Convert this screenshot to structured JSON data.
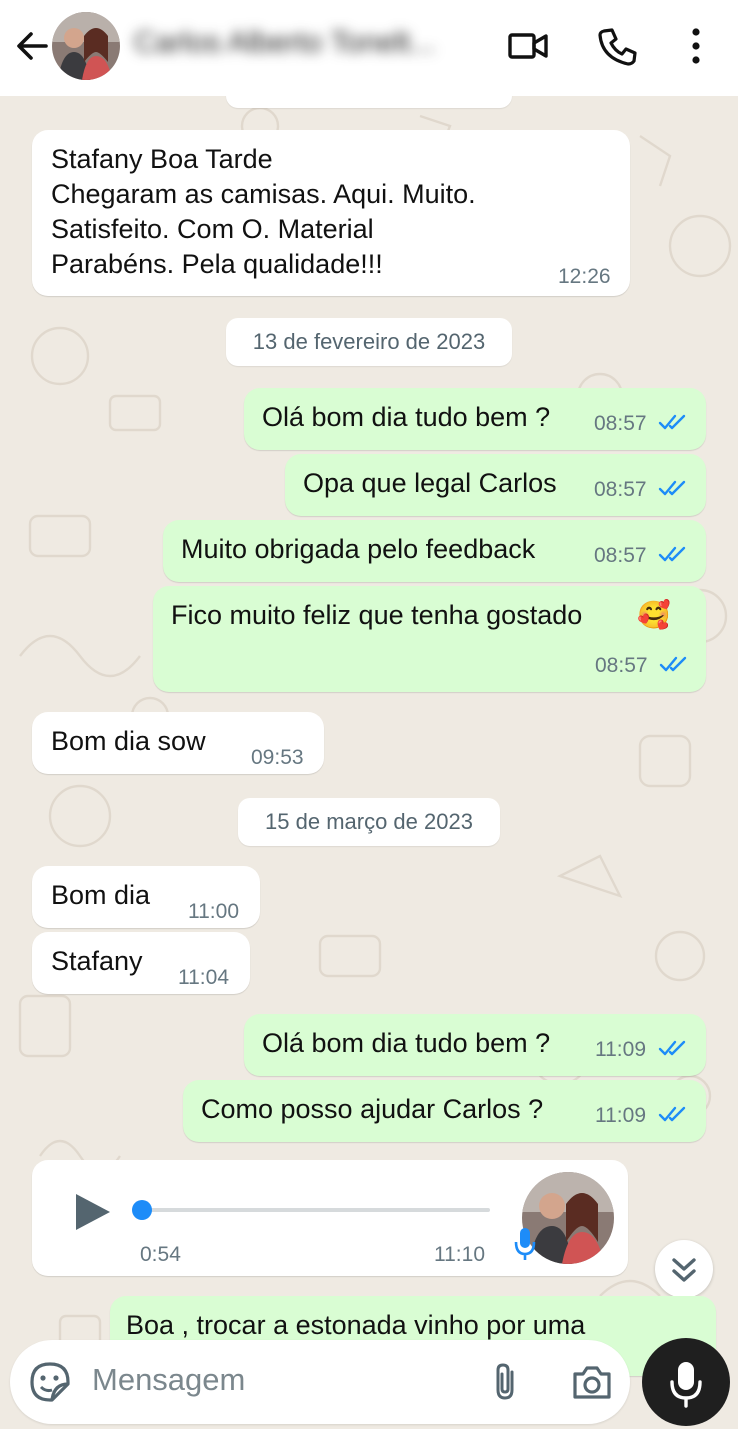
{
  "header": {
    "contact_name": "Carlos Alberto Tonelt...",
    "icons": [
      "back-arrow-icon",
      "video-call-icon",
      "phone-icon",
      "more-options-icon"
    ]
  },
  "messages": {
    "m1": {
      "lines": [
        "Stafany Boa Tarde",
        "Chegaram as camisas. Aqui. Muito.",
        "Satisfeito. Com O. Material",
        "Parabéns. Pela qualidade!!!"
      ],
      "time": "12:26"
    },
    "date1": "13 de fevereiro de 2023",
    "m2": {
      "text": "Olá bom dia tudo bem ?",
      "time": "08:57"
    },
    "m3": {
      "text": "Opa que legal Carlos",
      "time": "08:57"
    },
    "m4": {
      "text": "Muito obrigada pelo feedback",
      "time": "08:57"
    },
    "m5": {
      "text": "Fico muito feliz que tenha gostado",
      "emoji": "🥰",
      "time": "08:57"
    },
    "m6": {
      "text": "Bom dia sow",
      "time": "09:53"
    },
    "date2": "15 de março de 2023",
    "m7": {
      "text": "Bom dia",
      "time": "11:00"
    },
    "m8": {
      "text": "Stafany",
      "time": "11:04"
    },
    "m9": {
      "text": "Olá bom dia tudo bem ?",
      "time": "11:09"
    },
    "m10": {
      "text": "Como posso ajudar Carlos ?",
      "time": "11:09"
    },
    "voice": {
      "duration": "0:54",
      "time": "11:10",
      "progress": 0.0
    },
    "m11": {
      "text": "Boa , trocar a estonada vinho por uma"
    }
  },
  "input": {
    "placeholder": "Mensagem"
  },
  "colors": {
    "incoming": "#ffffff",
    "outgoing": "#d9fdd3",
    "read_ticks": "#53bdeb",
    "background": "#efeae2"
  }
}
